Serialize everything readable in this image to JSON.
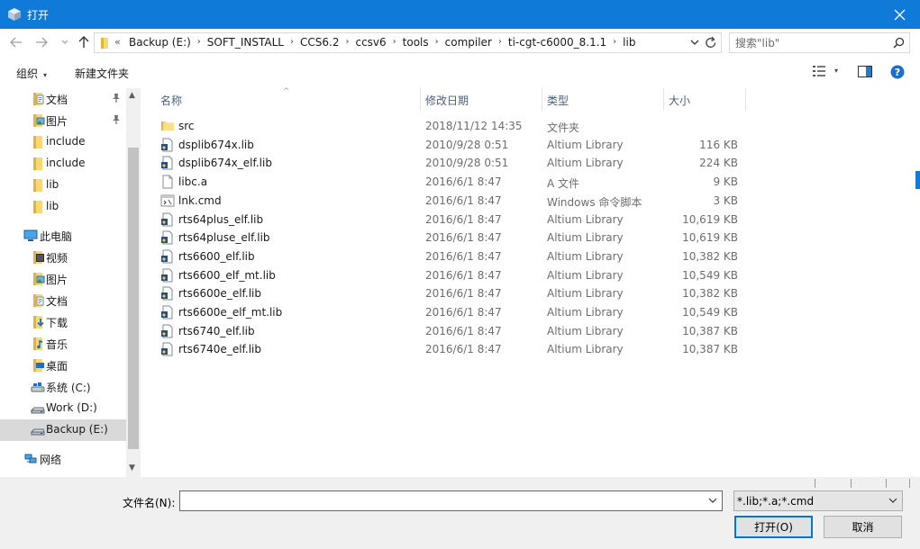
{
  "window": {
    "title": "打开",
    "close_glyph": "✕"
  },
  "nav": {
    "back": "←",
    "forward": "→",
    "recent": "⌄",
    "up": "↑"
  },
  "address": {
    "overflow": "«",
    "crumbs": [
      "Backup (E:)",
      "SOFT_INSTALL",
      "CCS6.2",
      "ccsv6",
      "tools",
      "compiler",
      "ti-cgt-c6000_8.1.1",
      "lib"
    ],
    "separator": "›"
  },
  "search": {
    "placeholder": "搜索\"lib\""
  },
  "toolbar": {
    "organize": "组织",
    "new_folder": "新建文件夹",
    "caret": "▾"
  },
  "sidebar": {
    "items": [
      {
        "label": "文档",
        "icon": "documents-icon",
        "pinned": true,
        "level": 1
      },
      {
        "label": "图片",
        "icon": "pictures-icon",
        "pinned": true,
        "level": 1
      },
      {
        "label": "include",
        "icon": "folder-icon",
        "pinned": false,
        "level": 1
      },
      {
        "label": "include",
        "icon": "folder-icon",
        "pinned": false,
        "level": 1
      },
      {
        "label": "lib",
        "icon": "folder-icon",
        "pinned": false,
        "level": 1
      },
      {
        "label": "lib",
        "icon": "folder-icon",
        "pinned": false,
        "level": 1
      },
      {
        "label": "此电脑",
        "icon": "computer-icon",
        "pinned": false,
        "level": 0
      },
      {
        "label": "视频",
        "icon": "videos-icon",
        "pinned": false,
        "level": 1
      },
      {
        "label": "图片",
        "icon": "pictures-icon",
        "pinned": false,
        "level": 1
      },
      {
        "label": "文档",
        "icon": "documents-icon",
        "pinned": false,
        "level": 1
      },
      {
        "label": "下载",
        "icon": "downloads-icon",
        "pinned": false,
        "level": 1
      },
      {
        "label": "音乐",
        "icon": "music-icon",
        "pinned": false,
        "level": 1
      },
      {
        "label": "桌面",
        "icon": "desktop-icon",
        "pinned": false,
        "level": 1
      },
      {
        "label": "系统 (C:)",
        "icon": "system-drive-icon",
        "pinned": false,
        "level": 1
      },
      {
        "label": "Work (D:)",
        "icon": "drive-icon",
        "pinned": false,
        "level": 1
      },
      {
        "label": "Backup (E:)",
        "icon": "drive-icon",
        "pinned": false,
        "level": 1,
        "selected": true
      },
      {
        "label": "网络",
        "icon": "network-icon",
        "pinned": false,
        "level": 0
      }
    ],
    "scroll_up": "▲",
    "scroll_down": "▼"
  },
  "columns": {
    "name": "名称",
    "date": "修改日期",
    "type": "类型",
    "size": "大小",
    "sort_arrow": "^"
  },
  "files": [
    {
      "name": "src",
      "date": "2018/11/12 14:35",
      "type": "文件夹",
      "size": "",
      "icon": "folder"
    },
    {
      "name": "dsplib674x.lib",
      "date": "2010/9/28 0:51",
      "type": "Altium Library",
      "size": "116 KB",
      "icon": "lib"
    },
    {
      "name": "dsplib674x_elf.lib",
      "date": "2010/9/28 0:51",
      "type": "Altium Library",
      "size": "224 KB",
      "icon": "lib"
    },
    {
      "name": "libc.a",
      "date": "2016/6/1 8:47",
      "type": "A 文件",
      "size": "9 KB",
      "icon": "file"
    },
    {
      "name": "lnk.cmd",
      "date": "2016/6/1 8:47",
      "type": "Windows 命令脚本",
      "size": "3 KB",
      "icon": "cmd"
    },
    {
      "name": "rts64plus_elf.lib",
      "date": "2016/6/1 8:47",
      "type": "Altium Library",
      "size": "10,619 KB",
      "icon": "lib"
    },
    {
      "name": "rts64pluse_elf.lib",
      "date": "2016/6/1 8:47",
      "type": "Altium Library",
      "size": "10,619 KB",
      "icon": "lib"
    },
    {
      "name": "rts6600_elf.lib",
      "date": "2016/6/1 8:47",
      "type": "Altium Library",
      "size": "10,382 KB",
      "icon": "lib"
    },
    {
      "name": "rts6600_elf_mt.lib",
      "date": "2016/6/1 8:47",
      "type": "Altium Library",
      "size": "10,549 KB",
      "icon": "lib"
    },
    {
      "name": "rts6600e_elf.lib",
      "date": "2016/6/1 8:47",
      "type": "Altium Library",
      "size": "10,382 KB",
      "icon": "lib"
    },
    {
      "name": "rts6600e_elf_mt.lib",
      "date": "2016/6/1 8:47",
      "type": "Altium Library",
      "size": "10,549 KB",
      "icon": "lib"
    },
    {
      "name": "rts6740_elf.lib",
      "date": "2016/6/1 8:47",
      "type": "Altium Library",
      "size": "10,387 KB",
      "icon": "lib"
    },
    {
      "name": "rts6740e_elf.lib",
      "date": "2016/6/1 8:47",
      "type": "Altium Library",
      "size": "10,387 KB",
      "icon": "lib"
    }
  ],
  "footer": {
    "filename_label": "文件名(N):",
    "filename_value": "",
    "filter_value": "*.lib;*.a;*.cmd",
    "open_label": "打开(O)",
    "cancel_label": "取消"
  },
  "colors": {
    "titlebar": "#0f7ad8",
    "selected_nav": "#d9d9d9",
    "header_text": "#4c607a",
    "dialog_bg": "#f0f0f0"
  }
}
